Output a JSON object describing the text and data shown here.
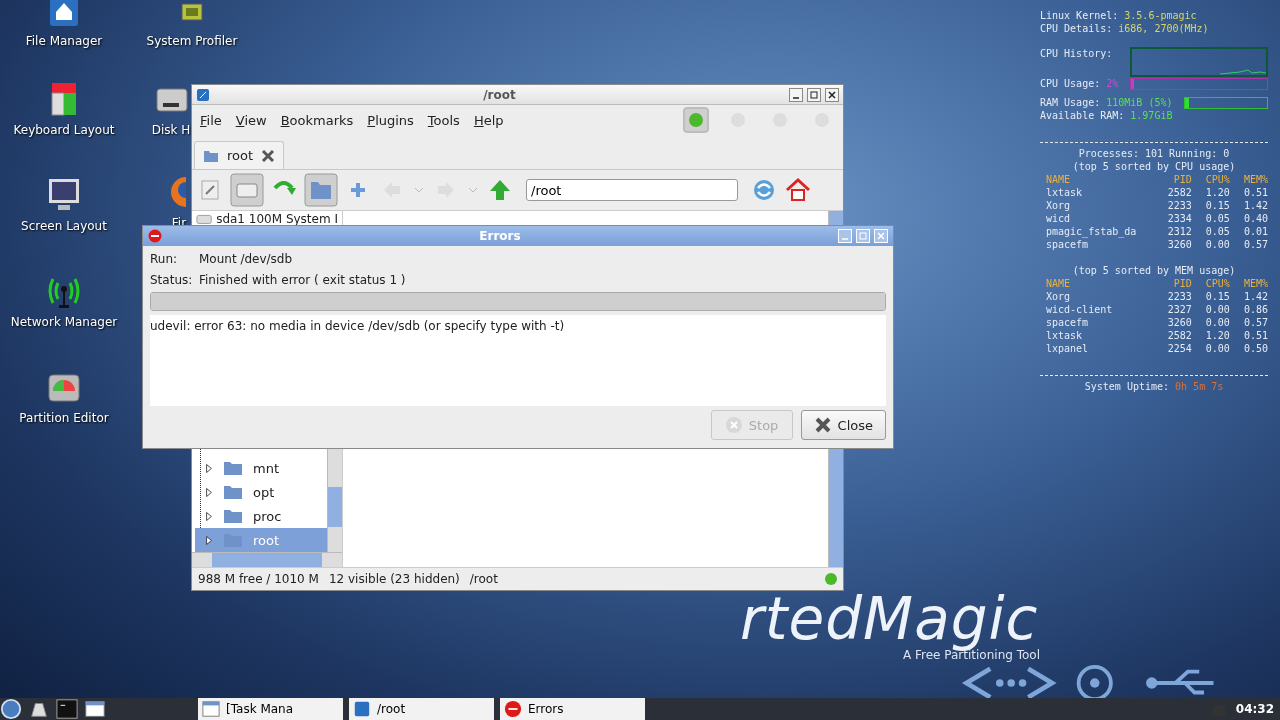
{
  "desktop_icons": [
    {
      "label": "File Manager",
      "kind": "home"
    },
    {
      "label": "System Profiler",
      "kind": "chip"
    },
    {
      "label": "Keyboard Layout",
      "kind": "keyboard"
    },
    {
      "label": "Disk H",
      "kind": "disk"
    },
    {
      "label": "Screen Layout",
      "kind": "monitor"
    },
    {
      "label": "Fir",
      "kind": "browser"
    },
    {
      "label": "Network Manager",
      "kind": "antenna"
    },
    {
      "label": "Partition Editor",
      "kind": "partition"
    }
  ],
  "wallpaper": {
    "logo": "rtedMagic",
    "tagline": "A Free Partitioning Tool"
  },
  "system_monitor": {
    "header": [
      {
        "label": "Linux Kernel:",
        "value": "3.5.6-pmagic"
      },
      {
        "label": "CPU Details:",
        "value": "i686, 2700(MHz)"
      }
    ],
    "cpu_history_label": "CPU History:",
    "cpu_usage": {
      "label": "CPU Usage:",
      "value": "2%",
      "level": 0.02
    },
    "ram_usage": {
      "label": "RAM Usage:",
      "value": "110MiB (5%)",
      "level": 0.05
    },
    "available_ram": {
      "label": "Available RAM:",
      "value": "1.97GiB"
    },
    "processes": "Processes: 101  Running: 0",
    "tables": [
      {
        "caption": "(top 5 sorted by CPU usage)",
        "columns": [
          "NAME",
          "PID",
          "CPU%",
          "MEM%"
        ],
        "rows": [
          [
            "lxtask",
            "2582",
            "1.20",
            "0.51"
          ],
          [
            "Xorg",
            "2233",
            "0.15",
            "1.42"
          ],
          [
            "wicd",
            "2334",
            "0.05",
            "0.40"
          ],
          [
            "pmagic_fstab_da",
            "2312",
            "0.05",
            "0.01"
          ],
          [
            "spacefm",
            "3260",
            "0.00",
            "0.57"
          ]
        ]
      },
      {
        "caption": "(top 5 sorted by MEM usage)",
        "columns": [
          "NAME",
          "PID",
          "CPU%",
          "MEM%"
        ],
        "rows": [
          [
            "Xorg",
            "2233",
            "0.15",
            "1.42"
          ],
          [
            "wicd-client",
            "2327",
            "0.00",
            "0.86"
          ],
          [
            "spacefm",
            "3260",
            "0.00",
            "0.57"
          ],
          [
            "lxtask",
            "2582",
            "1.20",
            "0.51"
          ],
          [
            "lxpanel",
            "2254",
            "0.00",
            "0.50"
          ]
        ]
      }
    ],
    "uptime": {
      "label": "System Uptime:",
      "value": "0h 5m 7s"
    }
  },
  "file_manager": {
    "title": "/root",
    "menus": [
      "File",
      "View",
      "Bookmarks",
      "Plugins",
      "Tools",
      "Help"
    ],
    "tab": {
      "label": "root",
      "selected": true
    },
    "path": "/root",
    "device_row": "sda1 100M System I",
    "tree": [
      {
        "label": "mnt",
        "selected": false
      },
      {
        "label": "opt",
        "selected": false
      },
      {
        "label": "proc",
        "selected": false
      },
      {
        "label": "root",
        "selected": true
      }
    ],
    "status": [
      "988 M free / 1010 M",
      "12 visible (23 hidden)",
      "/root"
    ]
  },
  "errors_dialog": {
    "title": "Errors",
    "fields": [
      {
        "label": "Run:",
        "value": "Mount /dev/sdb"
      },
      {
        "label": "Status:",
        "value": "Finished with error  ( exit status 1 )"
      }
    ],
    "progress": {
      "level": 1
    },
    "message": "udevil: error 63: no media in device /dev/sdb (or specify type with -t)",
    "buttons": [
      {
        "label": "Stop",
        "kind": "stop",
        "disabled": true
      },
      {
        "label": "Close",
        "kind": "close",
        "disabled": false
      }
    ]
  },
  "taskbar": {
    "tasks": [
      {
        "label": "[Task Mana",
        "kind": "monitor"
      },
      {
        "label": "/root",
        "kind": "folder"
      },
      {
        "label": "Errors",
        "kind": "error"
      }
    ],
    "clock": "04:32"
  }
}
